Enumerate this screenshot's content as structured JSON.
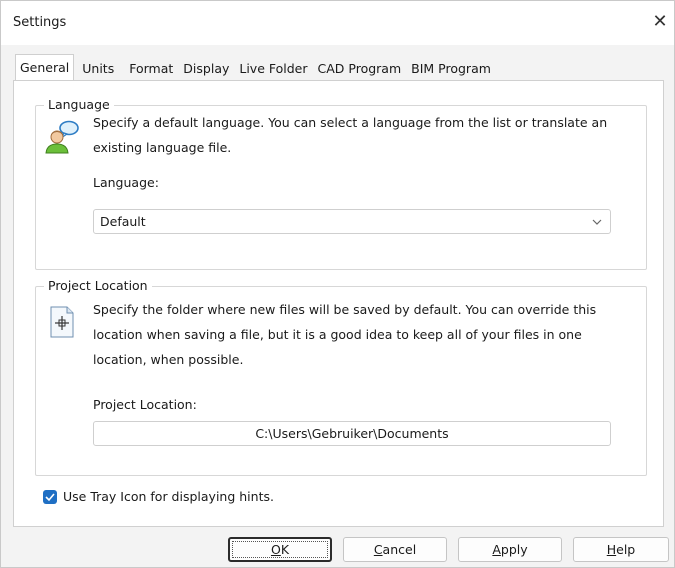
{
  "window": {
    "title": "Settings",
    "close_label": "✕"
  },
  "tabs": [
    {
      "label": "General",
      "active": true
    },
    {
      "label": "Units"
    },
    {
      "label": "Format"
    },
    {
      "label": "Display"
    },
    {
      "label": "Live Folder"
    },
    {
      "label": "CAD Program"
    },
    {
      "label": "BIM Program"
    }
  ],
  "language_group": {
    "legend": "Language",
    "description_line1": "Specify a default language. You can select a language from the list or translate an",
    "description_line2": "existing language file.",
    "field_label": "Language:",
    "selected_value": "Default",
    "icon": "person-speech-icon"
  },
  "project_group": {
    "legend": "Project Location",
    "description_line1": "Specify the folder where new files will be saved by default. You can override this",
    "description_line2": "location when saving a file, but it is a good idea to keep all of your files in one",
    "description_line3": "location, when possible.",
    "field_label": "Project Location:",
    "value": "C:\\Users\\Gebruiker\\Documents",
    "icon": "document-target-icon"
  },
  "tray_option": {
    "label": "Use Tray Icon for displaying hints.",
    "checked": true
  },
  "buttons": {
    "ok": {
      "rest": "K",
      "accel": "O"
    },
    "cancel": {
      "rest": "ancel",
      "accel": "C"
    },
    "apply": {
      "rest": "pply",
      "accel": "A"
    },
    "help": {
      "rest": "elp",
      "accel": "H"
    }
  },
  "colors": {
    "accent": "#1f6fc4",
    "panel": "#ffffff",
    "dialog": "#f3f3f3"
  }
}
